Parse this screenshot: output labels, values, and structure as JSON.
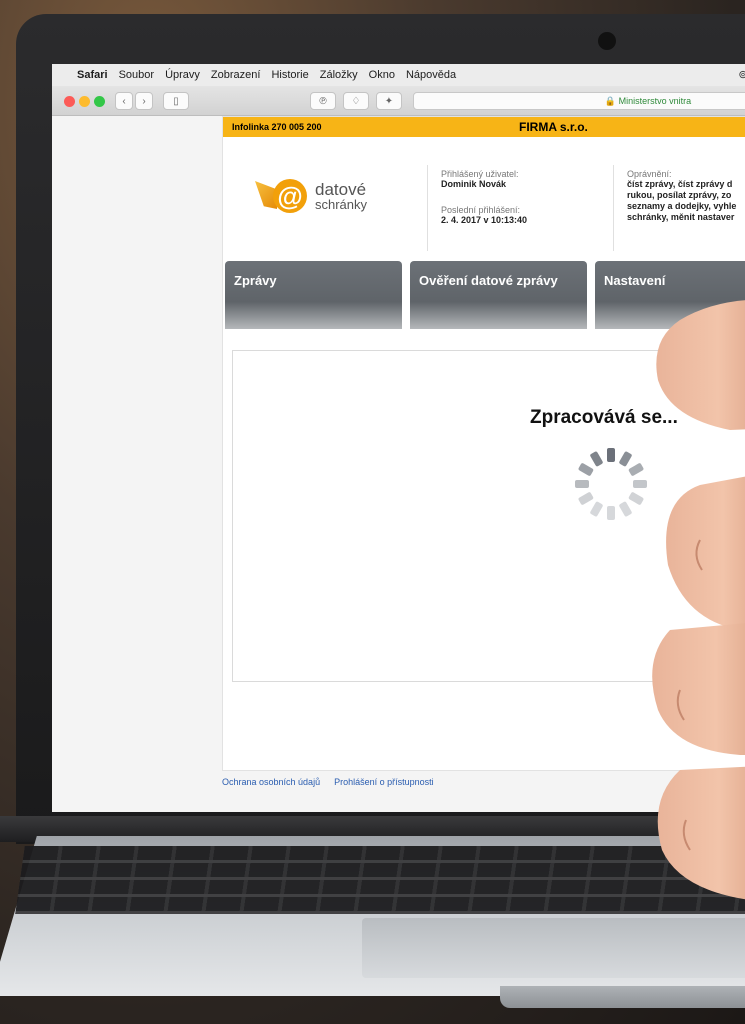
{
  "menubar": {
    "app": "Safari",
    "items": [
      "Soubor",
      "Úpravy",
      "Zobrazení",
      "Historie",
      "Záložky",
      "Okno",
      "Nápověda"
    ]
  },
  "toolbar": {
    "address": "Ministerstvo vnitra"
  },
  "site": {
    "infolinka": "Infolinka 270 005 200",
    "firm_name": "FIRMA s.r.o.",
    "logo_line1": "datové",
    "logo_line2": "schránky",
    "user_label": "Přihlášený uživatel:",
    "user_name": "Dominik Novák",
    "last_login_label": "Poslední přihlášení:",
    "last_login_value": "2. 4. 2017 v 10:13:40",
    "permissions_label": "Oprávnění:",
    "permissions_lines": [
      "číst zprávy, číst zprávy d",
      "rukou, posílat zprávy, zo",
      "seznamy a dodejky, vyhle",
      "schránky, měnit nastaver"
    ],
    "tabs": [
      "Zprávy",
      "Ověření datové zprávy",
      "Nastavení"
    ],
    "processing_text": "Zpracovává se...",
    "footer_links": [
      "Ochrana osobních údajů",
      "Prohlášení o přístupnosti"
    ]
  },
  "colors": {
    "accent_yellow": "#f7b416",
    "logo_orange": "#f2a00a",
    "tab_gray": "#6c7177",
    "link_blue": "#2a5db0"
  }
}
